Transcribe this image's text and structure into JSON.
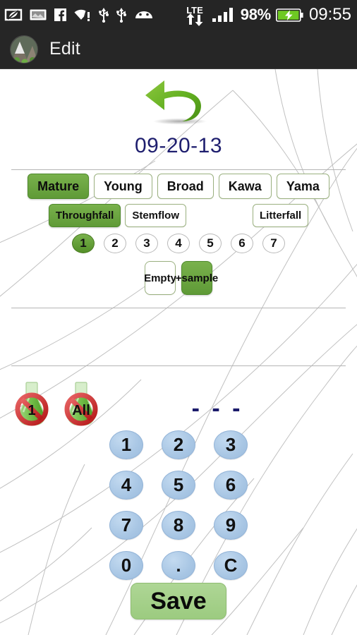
{
  "statusbar": {
    "icons": [
      "eco-leaf-icon",
      "screenshot-image-icon",
      "facebook-icon",
      "wifi-warning-icon",
      "usb-icon",
      "usb-icon",
      "android-head-icon"
    ],
    "network_label": "LTE",
    "signal_icon": "signal-bars-icon",
    "battery_percent": "98%",
    "battery_icon": "battery-charging-icon",
    "clock": "09:55"
  },
  "actionbar": {
    "avatar": "app-logo-mountain-avatar",
    "title": "Edit"
  },
  "main": {
    "undo_icon": "undo-arrow-icon",
    "date": "09-20-13",
    "plot_types": [
      {
        "label": "Mature",
        "selected": true
      },
      {
        "label": "Young",
        "selected": false
      },
      {
        "label": "Broad",
        "selected": false
      },
      {
        "label": "Kawa",
        "selected": false
      },
      {
        "label": "Yama",
        "selected": false
      }
    ],
    "flux_types": [
      {
        "label": "Throughfall",
        "selected": true
      },
      {
        "label": "Stemflow",
        "selected": false
      },
      {
        "label": "Litterfall",
        "selected": false
      }
    ],
    "collector_numbers": [
      {
        "label": "1",
        "selected": true
      },
      {
        "label": "2",
        "selected": false
      },
      {
        "label": "3",
        "selected": false
      },
      {
        "label": "4",
        "selected": false
      },
      {
        "label": "5",
        "selected": false
      },
      {
        "label": "6",
        "selected": false
      },
      {
        "label": "7",
        "selected": false
      }
    ],
    "sample_states": [
      {
        "label": "Empty",
        "selected": false
      },
      {
        "label": "+sample",
        "selected": true
      }
    ],
    "delete_buttons": [
      {
        "label": "1",
        "icon": "flask-forbidden-icon"
      },
      {
        "label": "All",
        "icon": "flask-forbidden-icon"
      }
    ],
    "value_display": "- - -",
    "keypad": [
      [
        "1",
        "2",
        "3"
      ],
      [
        "4",
        "5",
        "6"
      ],
      [
        "7",
        "8",
        "9"
      ],
      [
        "0",
        ".",
        "C"
      ]
    ],
    "save_label": "Save"
  },
  "colors": {
    "statusbar_bg": "#252525",
    "actionbar_bg": "#262626",
    "selected_green": "#6aa444",
    "chip_border": "#9ab07f",
    "date_blue": "#1e1e6e",
    "key_blue": "#a8c6e4",
    "save_green": "#a8d28a"
  }
}
